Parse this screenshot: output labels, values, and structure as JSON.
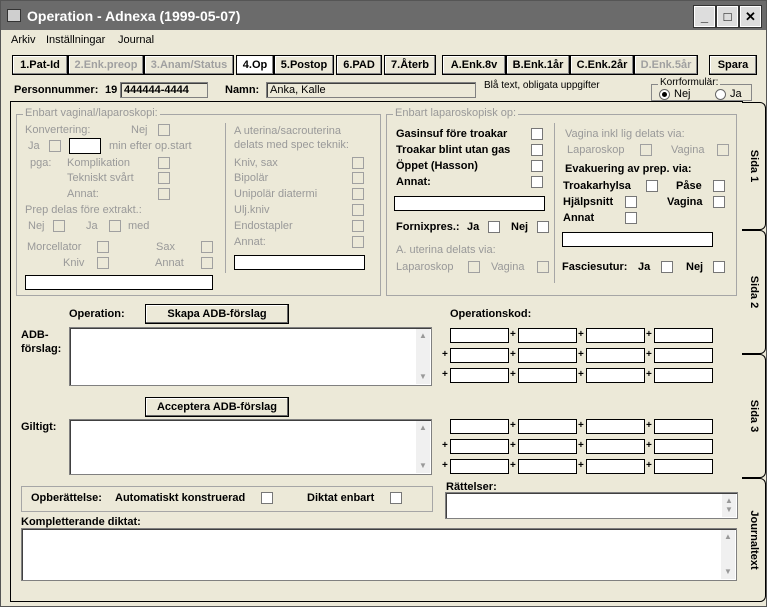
{
  "window": {
    "title": "Operation - Adnexa (1999-05-07)"
  },
  "menu": [
    "Arkiv",
    "Inställningar",
    "Journal"
  ],
  "tabs": [
    {
      "label": "1.Pat-Id",
      "state": "normal"
    },
    {
      "label": "2.Enk.preop",
      "state": "disabled"
    },
    {
      "label": "3.Anam/Status",
      "state": "disabled"
    },
    {
      "label": "4.Op",
      "state": "active"
    },
    {
      "label": "5.Postop",
      "state": "normal"
    },
    {
      "label": "6.PAD",
      "state": "normal"
    },
    {
      "label": "7.Återb",
      "state": "normal"
    },
    {
      "label": "A.Enk.8v",
      "state": "normal"
    },
    {
      "label": "B.Enk.1år",
      "state": "normal"
    },
    {
      "label": "C.Enk.2år",
      "state": "normal"
    },
    {
      "label": "D.Enk.5år",
      "state": "disabled"
    }
  ],
  "save_label": "Spara",
  "patient": {
    "pnr_label": "Personnummer:",
    "pnr_prefix": "19",
    "pnr_value": "444444-4444",
    "name_label": "Namn:",
    "name_value": "Anka, Kalle",
    "hint": "Blå text, obligata uppgifter",
    "korr_label": "Korrformulär:",
    "korr_nej": "Nej",
    "korr_ja": "Ja"
  },
  "vaginal": {
    "title": "Enbart vaginal/laparoskopi:",
    "konvertering": "Konvertering:",
    "nej": "Nej",
    "ja": "Ja",
    "min_after": "min efter op.start",
    "pga": "pga:",
    "komplikation": "Komplikation",
    "tekniskt": "Tekniskt svårt",
    "annat": "Annat:",
    "prep_title": "Prep delas före extrakt.:",
    "med": "med",
    "morcellator": "Morcellator",
    "sax": "Sax",
    "kniv": "Kniv",
    "annat2": "Annat"
  },
  "uterina": {
    "title": "A uterina/sacrouterina delats med spec teknik:",
    "items": [
      "Kniv, sax",
      "Bipolär",
      "Unipolär diatermi",
      "Ulj.kniv",
      "Endostapler",
      "Annat:"
    ]
  },
  "lap": {
    "title": "Enbart laparoskopisk op:",
    "gasinsuf": "Gasinsuf före troakar",
    "troakar": "Troakar blint utan gas",
    "oppet": "Öppet (Hasson)",
    "annat": "Annat:",
    "fornix": "Fornixpres.:",
    "ja": "Ja",
    "nej": "Nej",
    "auterina": "A. uterina delats via:",
    "laparoskop": "Laparoskop",
    "vagina": "Vagina",
    "vaginainkl": "Vagina inkl lig delats via:",
    "evakuering": "Evakuering av prep. via:",
    "troakarhylsa": "Troakarhylsa",
    "pase": "Påse",
    "hjalpsnitt": "Hjälpsnitt",
    "annat2": "Annat",
    "fasciesutur": "Fasciesutur:"
  },
  "operation": {
    "label": "Operation:",
    "skapa": "Skapa ADB-förslag",
    "adb_label1": "ADB-",
    "adb_label2": "förslag:",
    "kod_label": "Operationskod:",
    "acceptera": "Acceptera ADB-förslag",
    "giltigt": "Giltigt:",
    "opberattelse": "Opberättelse:",
    "auto": "Automatiskt konstruerad",
    "diktat": "Diktat enbart",
    "rattelser": "Rättelser:",
    "kompletterande": "Kompletterande diktat:"
  },
  "side_tabs": [
    "Sida 1",
    "Sida 2",
    "Sida 3",
    "Journaltext"
  ]
}
